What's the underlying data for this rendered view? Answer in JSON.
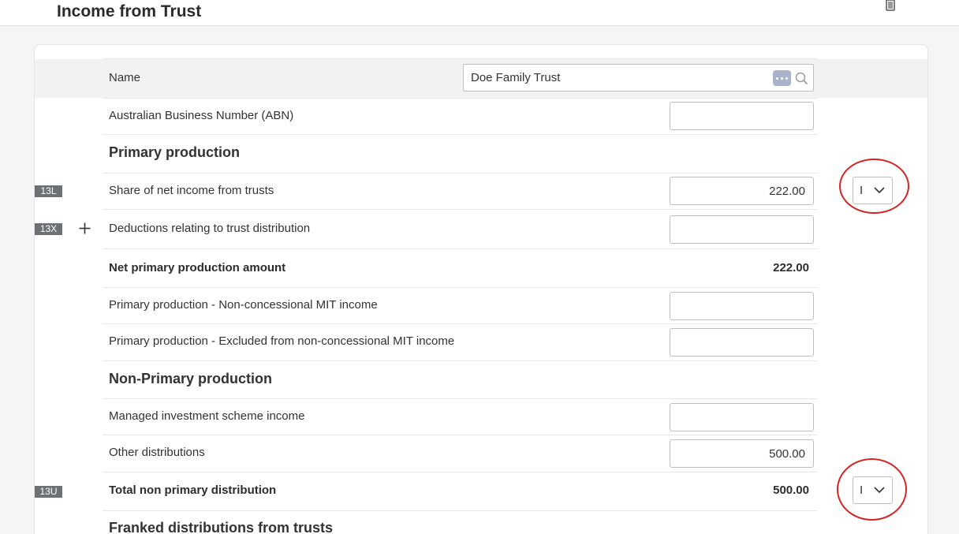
{
  "header": {
    "title": "Income from Trust"
  },
  "name_row": {
    "label": "Name",
    "value": "Doe Family Trust"
  },
  "abn": {
    "label": "Australian Business Number (ABN)",
    "value": ""
  },
  "primary": {
    "heading": "Primary production",
    "share": {
      "code": "13L",
      "label": "Share of net income from trusts",
      "value": "222.00",
      "dropdown": "I"
    },
    "deductions": {
      "code": "13X",
      "label": "Deductions relating to trust distribution",
      "value": ""
    },
    "net": {
      "label": "Net primary production amount",
      "value": "222.00"
    },
    "non_concessional": {
      "label": "Primary production - Non-concessional MIT income",
      "value": ""
    },
    "excluded": {
      "label": "Primary production - Excluded from non-concessional MIT income",
      "value": ""
    }
  },
  "non_primary": {
    "heading": "Non-Primary production",
    "managed": {
      "label": "Managed investment scheme income",
      "value": ""
    },
    "other": {
      "label": "Other distributions",
      "value": "500.00"
    },
    "total": {
      "code": "13U",
      "label": "Total non primary distribution",
      "value": "500.00",
      "dropdown": "I"
    }
  },
  "franked": {
    "heading": "Franked distributions from trusts"
  },
  "colors": {
    "accent": "#d42525",
    "badge": "#6d7176",
    "ellipsis": "#a9b3c9"
  },
  "icons": [
    "trash-icon",
    "ellipsis-icon",
    "search-icon",
    "plus-icon",
    "chevron-down-icon"
  ]
}
